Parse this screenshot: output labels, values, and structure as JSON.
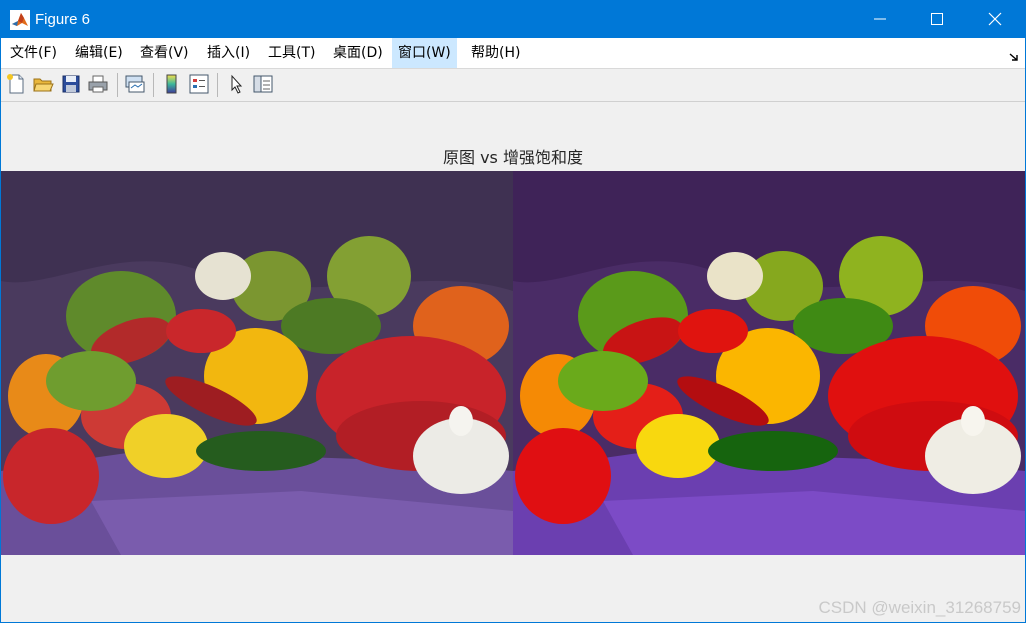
{
  "window": {
    "title": "Figure 6"
  },
  "menu": {
    "items": [
      {
        "label": "文件(F)"
      },
      {
        "label": "编辑(E)"
      },
      {
        "label": "查看(V)"
      },
      {
        "label": "插入(I)"
      },
      {
        "label": "工具(T)"
      },
      {
        "label": "桌面(D)"
      },
      {
        "label": "窗口(W)"
      },
      {
        "label": "帮助(H)"
      }
    ],
    "active_item": "窗口(W)"
  },
  "toolbar": {
    "buttons": [
      {
        "icon": "new-figure-icon"
      },
      {
        "icon": "open-file-icon"
      },
      {
        "icon": "save-icon"
      },
      {
        "icon": "print-icon"
      },
      {
        "icon": "link-plot-icon"
      },
      {
        "icon": "colorbar-icon"
      },
      {
        "icon": "legend-icon"
      },
      {
        "icon": "select-pointer-icon"
      },
      {
        "icon": "property-inspector-icon"
      }
    ]
  },
  "figure": {
    "title": "原图 vs 增强饱和度",
    "left_image": "original peppers image",
    "right_image": "saturation-enhanced peppers image"
  },
  "watermark": "CSDN @weixin_31268759",
  "colors": {
    "titlebar": "#0078d7",
    "menu_active": "#cce8ff",
    "figure_bg": "#f0f0f0"
  }
}
